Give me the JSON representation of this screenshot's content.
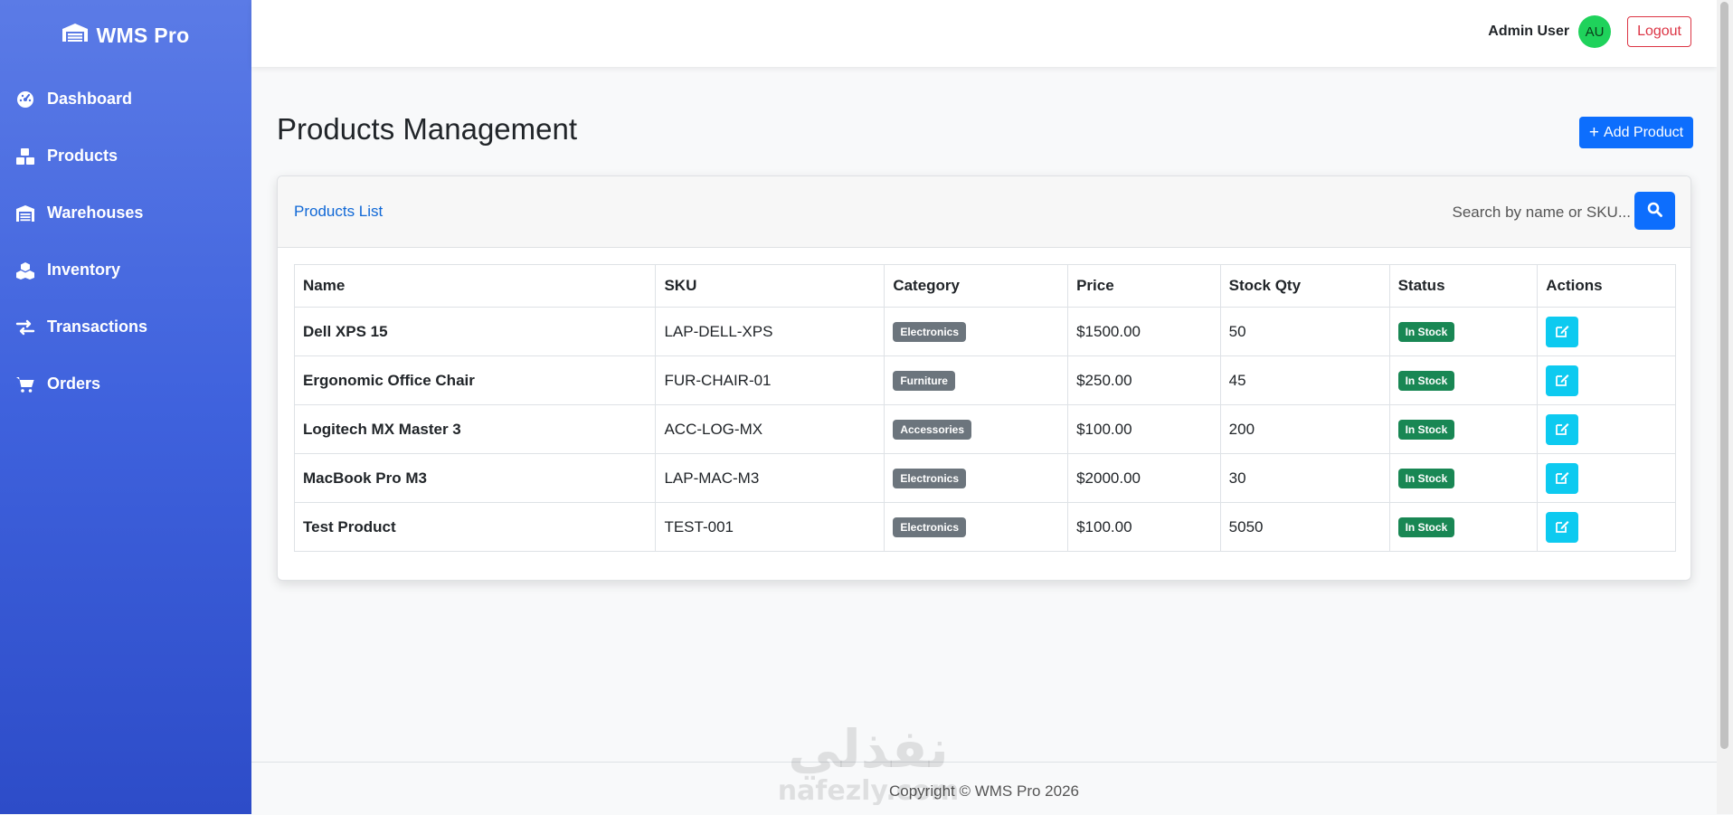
{
  "brand": {
    "name": "WMS Pro"
  },
  "sidebar": {
    "items": [
      {
        "label": "Dashboard",
        "icon": "dashboard-icon"
      },
      {
        "label": "Products",
        "icon": "boxes-icon"
      },
      {
        "label": "Warehouses",
        "icon": "warehouse-icon"
      },
      {
        "label": "Inventory",
        "icon": "cubes-icon"
      },
      {
        "label": "Transactions",
        "icon": "exchange-icon"
      },
      {
        "label": "Orders",
        "icon": "cart-icon"
      }
    ]
  },
  "topbar": {
    "user_name": "Admin User",
    "avatar_initials": "AU",
    "logout_label": "Logout"
  },
  "page": {
    "title": "Products Management",
    "add_button_label": "Add Product"
  },
  "card": {
    "title": "Products List",
    "search_placeholder": "Search by name or SKU..."
  },
  "table": {
    "headers": [
      "Name",
      "SKU",
      "Category",
      "Price",
      "Stock Qty",
      "Status",
      "Actions"
    ],
    "rows": [
      {
        "name": "Dell XPS 15",
        "sku": "LAP-DELL-XPS",
        "category": "Electronics",
        "price": "$1500.00",
        "stock": "50",
        "status": "In Stock"
      },
      {
        "name": "Ergonomic Office Chair",
        "sku": "FUR-CHAIR-01",
        "category": "Furniture",
        "price": "$250.00",
        "stock": "45",
        "status": "In Stock"
      },
      {
        "name": "Logitech MX Master 3",
        "sku": "ACC-LOG-MX",
        "category": "Accessories",
        "price": "$100.00",
        "stock": "200",
        "status": "In Stock"
      },
      {
        "name": "MacBook Pro M3",
        "sku": "LAP-MAC-M3",
        "category": "Electronics",
        "price": "$2000.00",
        "stock": "30",
        "status": "In Stock"
      },
      {
        "name": "Test Product",
        "sku": "TEST-001",
        "category": "Electronics",
        "price": "$100.00",
        "stock": "5050",
        "status": "In Stock"
      }
    ]
  },
  "footer": {
    "text": "Copyright © WMS Pro 2026"
  },
  "watermark": {
    "arabic": "نفذلي",
    "latin": "nafezly.com"
  },
  "colors": {
    "primary": "#0d6efd",
    "info": "#0dcaf0",
    "success": "#198754",
    "secondary": "#6c757d",
    "danger": "#dc3545",
    "avatar": "#1fd25b",
    "sidebar_top": "#5b7be6",
    "sidebar_bottom": "#2d4cc8"
  }
}
